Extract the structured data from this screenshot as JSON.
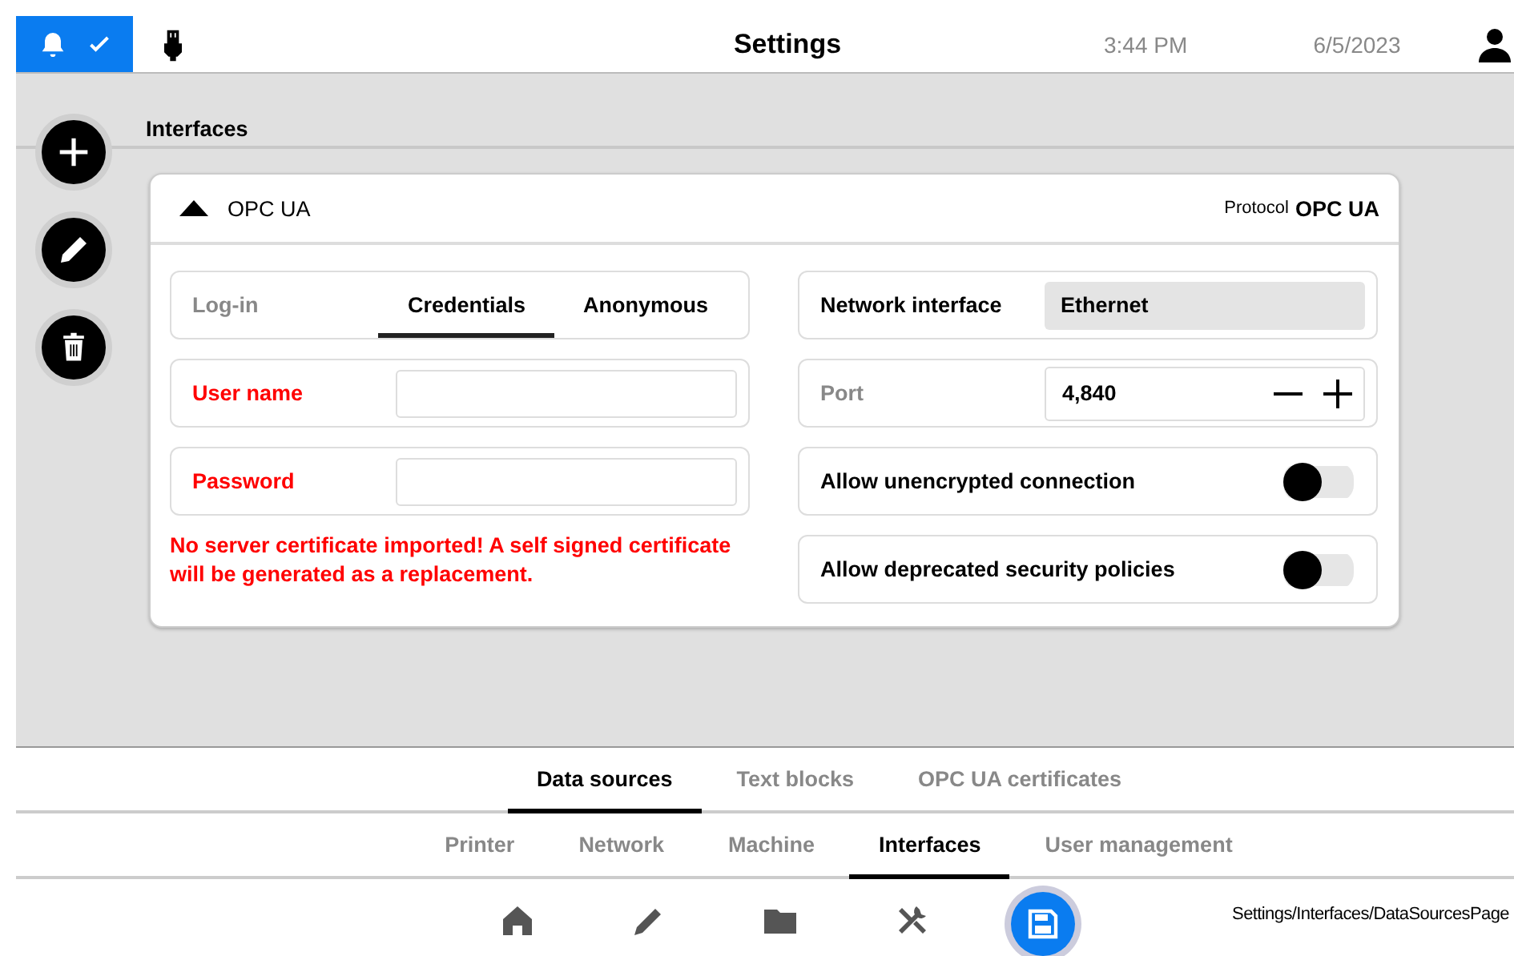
{
  "header": {
    "notifications_ok": true,
    "title": "Settings",
    "time": "3:44 PM",
    "date": "6/5/2023"
  },
  "section_title": "Interfaces",
  "card": {
    "expanded": true,
    "name": "OPC UA",
    "protocol_label": "Protocol",
    "protocol": "OPC UA",
    "login": {
      "label": "Log-in",
      "options": [
        {
          "label": "Credentials",
          "selected": true
        },
        {
          "label": "Anonymous",
          "selected": false
        }
      ]
    },
    "fields": [
      {
        "label": "User name",
        "invalid": true
      },
      {
        "label": "Password",
        "invalid": true
      }
    ],
    "warning": "No server certificate imported! A self signed certificate will be generated as a replacement.",
    "network_interface": {
      "label": "Network interface",
      "value": "Ethernet"
    },
    "port": {
      "label": "Port",
      "value": "4,840"
    },
    "toggles": [
      {
        "label": "Allow unencrypted connection",
        "on": false
      },
      {
        "label": "Allow deprecated security policies",
        "on": false
      }
    ]
  },
  "tabs": [
    {
      "label": "Data sources",
      "selected": true
    },
    {
      "label": "Text blocks",
      "selected": false
    },
    {
      "label": "OPC UA certificates",
      "selected": false
    }
  ],
  "subtabs": [
    {
      "label": "Printer",
      "selected": false
    },
    {
      "label": "Network",
      "selected": false
    },
    {
      "label": "Machine",
      "selected": false
    },
    {
      "label": "Interfaces",
      "selected": true
    },
    {
      "label": "User management",
      "selected": false
    }
  ],
  "nav": [
    {
      "kind": "home",
      "selected": false
    },
    {
      "kind": "edit",
      "selected": false
    },
    {
      "kind": "folder",
      "selected": false
    },
    {
      "kind": "tools",
      "selected": false
    },
    {
      "kind": "save",
      "selected": true
    }
  ],
  "path": "Settings/Interfaces/DataSourcesPage"
}
